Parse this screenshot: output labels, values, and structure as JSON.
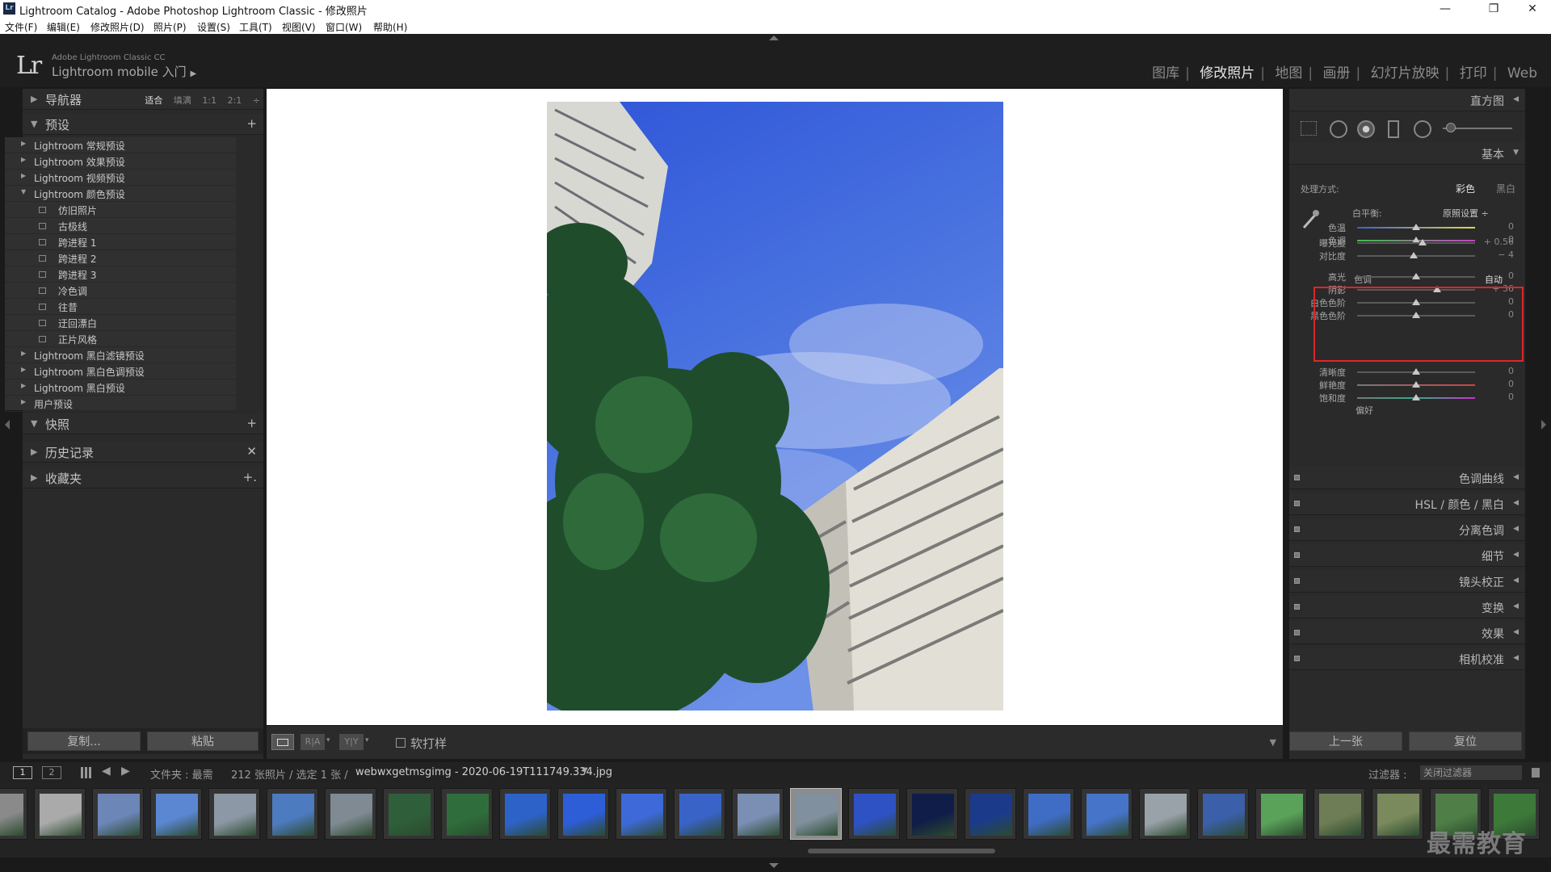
{
  "window": {
    "title": "Lightroom Catalog - Adobe Photoshop Lightroom Classic - 修改照片",
    "minimize": "—",
    "restore": "❐",
    "close": "✕"
  },
  "menu": [
    "文件(F)",
    "编辑(E)",
    "修改照片(D)",
    "照片(P)",
    "设置(S)",
    "工具(T)",
    "视图(V)",
    "窗口(W)",
    "帮助(H)"
  ],
  "identity": {
    "logo": "Lr",
    "product": "Adobe Lightroom Classic CC",
    "mobile": "Lightroom mobile 入门",
    "arrow": "▶"
  },
  "modules": [
    {
      "label": "图库",
      "active": false
    },
    {
      "label": "修改照片",
      "active": true
    },
    {
      "label": "地图",
      "active": false
    },
    {
      "label": "画册",
      "active": false
    },
    {
      "label": "幻灯片放映",
      "active": false
    },
    {
      "label": "打印",
      "active": false
    },
    {
      "label": "Web",
      "active": false
    }
  ],
  "left": {
    "navigator": {
      "label": "导航器",
      "tri": "▶",
      "zoom": [
        "适合",
        "填满",
        "1:1",
        "2:1"
      ],
      "zoom_selected": "适合",
      "more": "÷"
    },
    "presets": {
      "label": "预设",
      "tri": "▼",
      "add": "+"
    },
    "preset_items": [
      {
        "level": 0,
        "open": false,
        "text": "Lightroom 常规预设"
      },
      {
        "level": 0,
        "open": false,
        "text": "Lightroom 效果预设"
      },
      {
        "level": 0,
        "open": false,
        "text": "Lightroom 视频预设"
      },
      {
        "level": 0,
        "open": true,
        "text": "Lightroom 颜色预设"
      },
      {
        "level": 1,
        "text": "仿旧照片"
      },
      {
        "level": 1,
        "text": "古极线"
      },
      {
        "level": 1,
        "text": "跨进程 1"
      },
      {
        "level": 1,
        "text": "跨进程 2"
      },
      {
        "level": 1,
        "text": "跨进程 3"
      },
      {
        "level": 1,
        "text": "冷色调"
      },
      {
        "level": 1,
        "text": "往昔"
      },
      {
        "level": 1,
        "text": "迂回漂白"
      },
      {
        "level": 1,
        "text": "正片风格"
      },
      {
        "level": 0,
        "open": false,
        "text": "Lightroom 黑白滤镜预设"
      },
      {
        "level": 0,
        "open": false,
        "text": "Lightroom 黑白色调预设"
      },
      {
        "level": 0,
        "open": false,
        "text": "Lightroom 黑白预设"
      },
      {
        "level": 0,
        "open": false,
        "text": "用户预设"
      }
    ],
    "snapshots": {
      "label": "快照",
      "tri": "▼",
      "add": "+"
    },
    "history": {
      "label": "历史记录",
      "tri": "▶",
      "clear": "✕"
    },
    "collections": {
      "label": "收藏夹",
      "tri": "▶",
      "add": "+."
    },
    "copy_button": "复制...",
    "paste_button": "粘贴"
  },
  "toolbar": {
    "softproof_label": "软打样",
    "view_ry": "R|A",
    "view_yy": "Y|Y"
  },
  "right": {
    "histogram": "直方图",
    "basic": "基本",
    "treatment_label": "处理方式:",
    "treatment_color": "彩色",
    "treatment_bw": "黑白",
    "wb_label": "白平衡:",
    "wb_value": "原照设置 ÷",
    "tone_label": "色调",
    "tone_auto": "自动",
    "presence_label": "偏好",
    "sliders_wb": [
      {
        "label": "色温",
        "value": "0",
        "pos": 0.5
      },
      {
        "label": "色调",
        "value": "0",
        "pos": 0.5
      }
    ],
    "sliders_tone": [
      {
        "label": "曝光度",
        "value": "+ 0.56",
        "pos": 0.556
      },
      {
        "label": "对比度",
        "value": "− 4",
        "pos": 0.48
      },
      {
        "label": "高光",
        "value": "0",
        "pos": 0.5
      },
      {
        "label": "阴影",
        "value": "+ 36",
        "pos": 0.68
      },
      {
        "label": "白色色阶",
        "value": "0",
        "pos": 0.5
      },
      {
        "label": "黑色色阶",
        "value": "0",
        "pos": 0.5
      }
    ],
    "sliders_presence": [
      {
        "label": "清晰度",
        "value": "0",
        "pos": 0.5
      },
      {
        "label": "鲜艳度",
        "value": "0",
        "pos": 0.5
      },
      {
        "label": "饱和度",
        "value": "0",
        "pos": 0.5
      }
    ],
    "panels": [
      "色调曲线",
      "HSL / 颜色 / 黑白",
      "分离色调",
      "细节",
      "镜头校正",
      "变换",
      "效果",
      "相机校准"
    ],
    "prev_button": "上一张",
    "reset_button": "复位"
  },
  "filmstrip": {
    "view1": "1",
    "view2": "2",
    "source": "文件夹 : 最需",
    "count": "212 张照片 / 选定 1 张 /",
    "filename": "webwxgetmsgimg - 2020-06-19T111749.334.jpg",
    "filter_label": "过滤器 :",
    "filter_value": "关闭过滤器",
    "selected_index": 14,
    "thumb_colors": [
      "#8a8a8a",
      "#aaaaaa",
      "#6c86b8",
      "#5b86d2",
      "#8d98a6",
      "#4d7bc0",
      "#7f8a93",
      "#2f5f3a",
      "#2f6e3c",
      "#2d63c9",
      "#2d5ed8",
      "#3d6ad8",
      "#3a63c7",
      "#7a8fb3",
      "#80909e",
      "#2e52c4",
      "#0f1d48",
      "#1b3b8a",
      "#3f6dc5",
      "#4574c9",
      "#9aa2a9",
      "#3b5fa8",
      "#5aa15a",
      "#6e7d55",
      "#7a8a5c",
      "#4f7f47",
      "#3d7a3a"
    ]
  },
  "watermark": "最需教育"
}
